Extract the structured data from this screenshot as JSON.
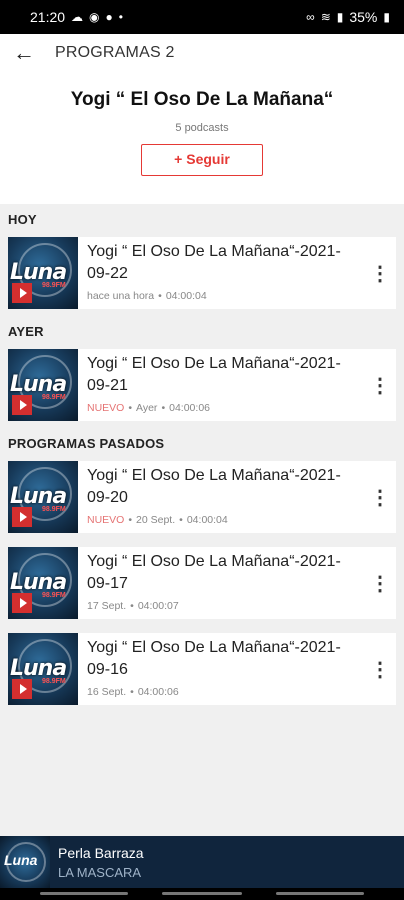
{
  "status_bar": {
    "time": "21:20",
    "left_icons": [
      "cloud-icon",
      "messenger-icon",
      "facebook-icon",
      "dot-icon"
    ],
    "right_icons": [
      "link-icon",
      "wifi-icon",
      "signal-icon"
    ],
    "battery": "35%"
  },
  "app_bar": {
    "title": "PROGRAMAS 2"
  },
  "header": {
    "show_title": "Yogi “ El Oso De La Mañana“",
    "podcast_count": "5 podcasts",
    "follow_label": "+ Seguir"
  },
  "sections": [
    {
      "title": "HOY",
      "episodes": [
        {
          "title": "Yogi “ El Oso De La Mañana“-2021-09-22",
          "new_label": "",
          "date": "hace una hora",
          "duration": "04:00:04"
        }
      ]
    },
    {
      "title": "AYER",
      "episodes": [
        {
          "title": "Yogi “ El Oso De La Mañana“-2021-09-21",
          "new_label": "NUEVO",
          "date": "Ayer",
          "duration": "04:00:06"
        }
      ]
    },
    {
      "title": "PROGRAMAS PASADOS",
      "episodes": [
        {
          "title": "Yogi “ El Oso De La Mañana“-2021-09-20",
          "new_label": "NUEVO",
          "date": "20 Sept.",
          "duration": "04:00:04"
        },
        {
          "title": "Yogi “ El Oso De La Mañana“-2021-09-17",
          "new_label": "",
          "date": "17 Sept.",
          "duration": "04:00:07"
        },
        {
          "title": "Yogi “ El Oso De La Mañana“-2021-09-16",
          "new_label": "",
          "date": "16 Sept.",
          "duration": "04:00:06"
        }
      ]
    }
  ],
  "thumbnail": {
    "logo_text": "Luna",
    "frequency": "98.9FM"
  },
  "mini_player": {
    "name": "Perla Barraza",
    "subtitle": "LA MASCARA"
  },
  "colors": {
    "accent": "#e53935",
    "player_bg": "#10253d",
    "background": "#f0f0f0"
  }
}
